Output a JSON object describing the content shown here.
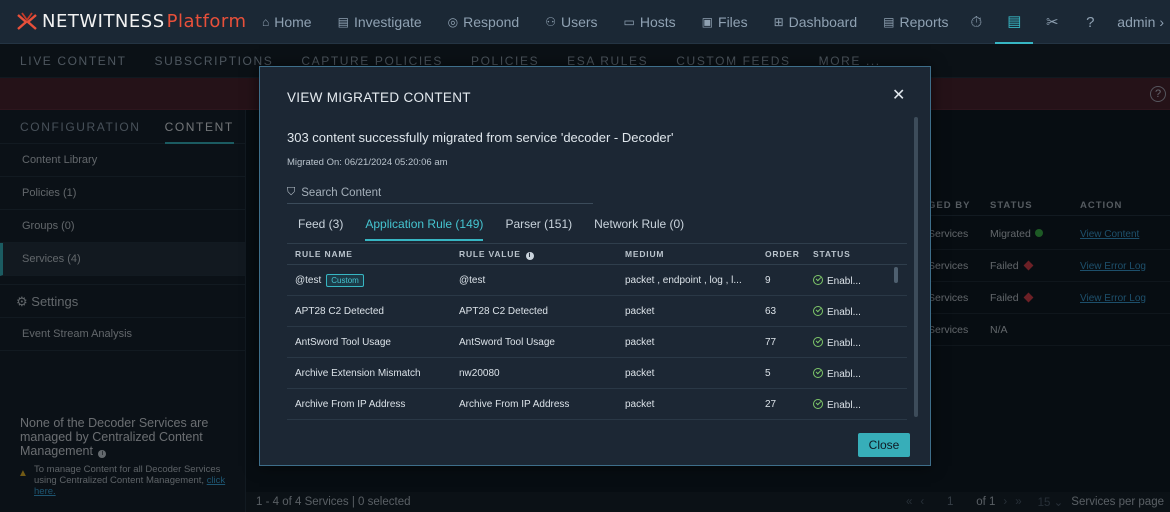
{
  "brand": {
    "name": "NETWITNESS",
    "product": "Platform"
  },
  "nav": [
    {
      "icon": "home-icon",
      "glyph": "⌂",
      "label": "Home"
    },
    {
      "icon": "investigate-icon",
      "glyph": "▤",
      "label": "Investigate"
    },
    {
      "icon": "respond-icon",
      "glyph": "◎",
      "label": "Respond"
    },
    {
      "icon": "users-icon",
      "glyph": "⚇",
      "label": "Users"
    },
    {
      "icon": "hosts-icon",
      "glyph": "▭",
      "label": "Hosts"
    },
    {
      "icon": "files-icon",
      "glyph": "▣",
      "label": "Files"
    },
    {
      "icon": "dashboard-icon",
      "glyph": "⊞",
      "label": "Dashboard"
    },
    {
      "icon": "reports-icon",
      "glyph": "▤",
      "label": "Reports"
    }
  ],
  "header_right": {
    "user": "admin",
    "chevron": "›"
  },
  "subnav": [
    "LIVE CONTENT",
    "SUBSCRIPTIONS",
    "CAPTURE POLICIES",
    "POLICIES",
    "ESA RULES",
    "CUSTOM FEEDS",
    "MORE ..."
  ],
  "sidebar": {
    "tabs": [
      "CONFIGURATION",
      "CONTENT"
    ],
    "items": [
      "Content Library",
      "Policies (1)",
      "Groups (0)",
      "Services (4)"
    ],
    "settings_heading": "Settings",
    "settings_items": [
      "Event Stream Analysis"
    ],
    "note_title": "None of the Decoder Services are managed by Centralized Content Management",
    "note_body": "To manage Content for all Decoder Services using Centralized Content Management, ",
    "note_link": "click here."
  },
  "background_table": {
    "columns": [
      "GED BY",
      "STATUS",
      "ACTION"
    ],
    "rows": [
      {
        "managed_by": "Services",
        "status": "Migrated",
        "status_kind": "ok",
        "action": "View Content"
      },
      {
        "managed_by": "Services",
        "status": "Failed",
        "status_kind": "fail",
        "action": "View Error Log"
      },
      {
        "managed_by": "Services",
        "status": "Failed",
        "status_kind": "fail",
        "action": "View Error Log"
      },
      {
        "managed_by": "Services",
        "status": "N/A",
        "status_kind": "none",
        "action": ""
      }
    ]
  },
  "footer": {
    "count": "1 - 4 of 4 Services | 0 selected",
    "page": "1",
    "of": "of 1",
    "per_page": "15",
    "per_page_label": "Services per page"
  },
  "modal": {
    "title": "VIEW MIGRATED CONTENT",
    "success": "303 content successfully migrated from service 'decoder - Decoder'",
    "migrated_on": "Migrated On: 06/21/2024 05:20:06 am",
    "search_placeholder": "Search Content",
    "tabs": [
      "Feed (3)",
      "Application Rule (149)",
      "Parser (151)",
      "Network Rule (0)"
    ],
    "active_tab": 1,
    "columns": [
      "RULE NAME",
      "RULE VALUE",
      "MEDIUM",
      "ORDER",
      "STATUS"
    ],
    "rows": [
      {
        "name": "@test",
        "badge": "Custom",
        "value": "@test",
        "medium": "packet , endpoint , log , l...",
        "order": "9",
        "status": "Enabl..."
      },
      {
        "name": "APT28 C2 Detected",
        "badge": "",
        "value": "APT28 C2 Detected",
        "medium": "packet",
        "order": "63",
        "status": "Enabl..."
      },
      {
        "name": "AntSword Tool Usage",
        "badge": "",
        "value": "AntSword Tool Usage",
        "medium": "packet",
        "order": "77",
        "status": "Enabl..."
      },
      {
        "name": "Archive Extension Mismatch",
        "badge": "",
        "value": "nw20080",
        "medium": "packet",
        "order": "5",
        "status": "Enabl..."
      },
      {
        "name": "Archive From IP Address",
        "badge": "",
        "value": "Archive From IP Address",
        "medium": "packet",
        "order": "27",
        "status": "Enabl..."
      }
    ],
    "close_label": "Close"
  },
  "colors": {
    "accent": "#37b6c3",
    "brand_red": "#e8503a",
    "ok": "#3ab54a",
    "fail": "#d8404c"
  }
}
